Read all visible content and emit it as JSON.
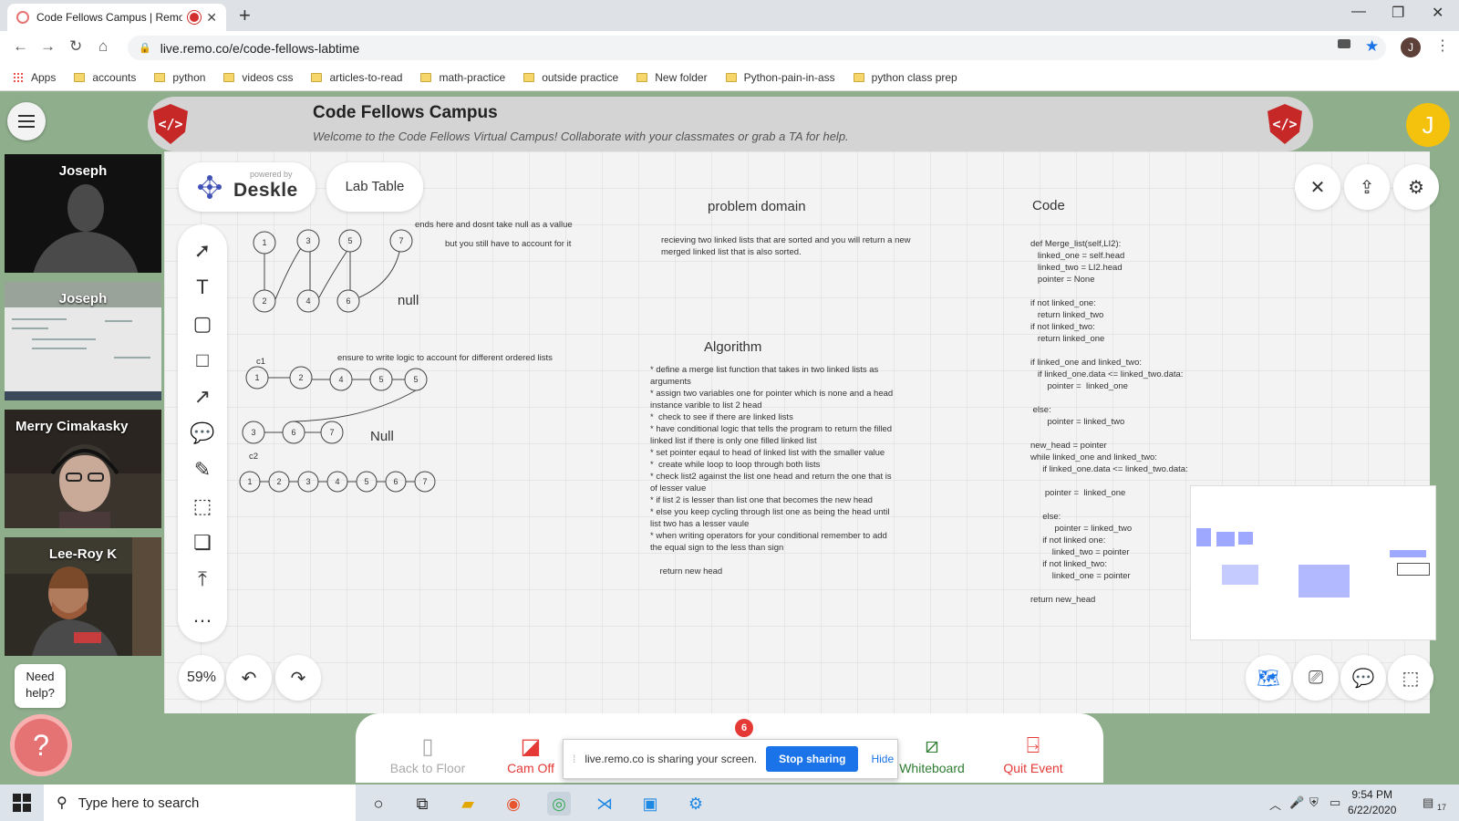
{
  "browser": {
    "tab_title": "Code Fellows Campus | Remo",
    "url": "live.remo.co/e/code-fellows-labtime",
    "profile_initial": "J",
    "bookmarks": [
      "accounts",
      "python",
      "videos css",
      "articles-to-read",
      "math-practice",
      "outside practice",
      "New folder",
      "Python-pain-in-ass",
      "python class prep"
    ],
    "apps_label": "Apps"
  },
  "header": {
    "title": "Code Fellows Campus",
    "subtitle": "Welcome to the Code Fellows Virtual Campus! Collaborate with your classmates or grab a TA for help.",
    "logo_text": "</>",
    "user_initial": "J"
  },
  "participants": [
    {
      "name": "Joseph"
    },
    {
      "name": "Joseph"
    },
    {
      "name": "Merry Cimakasky"
    },
    {
      "name": "Lee-Roy K"
    }
  ],
  "whiteboard": {
    "powered_by": "powered by",
    "brand": "Deskle",
    "table_name": "Lab Table",
    "zoom": "59%",
    "headings": {
      "problem_domain": "problem domain",
      "code": "Code",
      "algorithm": "Algorithm"
    },
    "notes": {
      "ends_here": "ends here and dosnt take null as a vallue",
      "account_for": "but you still have to account for it",
      "null_1": "null",
      "ensure": "ensure to write logic to account for different ordered lists",
      "null_2": "Null",
      "c1": "c1",
      "c2": "c2"
    },
    "diagram_nodes": {
      "row1_top": [
        "1",
        "3",
        "5",
        "7"
      ],
      "row1_bottom": [
        "2",
        "4",
        "6"
      ],
      "list_c1": [
        "1",
        "2",
        "4",
        "5",
        "5"
      ],
      "list_c2": [
        "3",
        "6",
        "7"
      ],
      "merged": [
        "1",
        "2",
        "3",
        "4",
        "5",
        "6",
        "7"
      ]
    },
    "problem_text": [
      "recieving two linked lists that are sorted and you will return a new",
      "merged linked list that is also sorted."
    ],
    "algorithm_text": [
      "* define a merge list function that takes in two linked lists as",
      "arguments",
      "* assign two variables one for pointer which is none and a head",
      "instance varible to list 2 head",
      "*  check to see if there are linked lists",
      "* have conditional logic that tells the program to return the filled",
      "linked list if there is only one filled linked list",
      "* set pointer eqaul to head of linked list with the smaller value",
      "*  create while loop to loop through both lists",
      "* check list2 against the list one head and return the one that is",
      "of lesser value",
      "* if list 2 is lesser than list one that becomes the new head",
      "* else you keep cycling through list one as being the head until",
      "list two has a lesser vaule",
      "* when writing operators for your conditional remember to add",
      "the equal sign to the less than sign",
      "",
      "    return new head"
    ],
    "code_lines": [
      "def Merge_list(self,LI2):",
      "   linked_one = self.head",
      "   linked_two = LI2.head",
      "   pointer = None",
      "",
      "if not linked_one:",
      "   return linked_two",
      "if not linked_two:",
      "   return linked_one",
      "",
      "if linked_one and linked_two:",
      "   if linked_one.data <= linked_two.data:",
      "       pointer =  linked_one",
      "",
      " else:",
      "       pointer = linked_two",
      "",
      "new_head = pointer",
      "while linked_one and linked_two:",
      "     if linked_one.data <= linked_two.data:",
      "",
      "      pointer =  linked_one",
      "",
      "     else:",
      "          pointer = linked_two",
      "     if not linked one:",
      "         linked_two = pointer",
      "     if not linked_two:",
      "         linked_one = pointer",
      "",
      "return new_head"
    ]
  },
  "controls": {
    "back_to_floor": "Back to Floor",
    "cam_off": "Cam Off",
    "whiteboard": "Whiteboard",
    "quit_event": "Quit Event",
    "chat_badge": "6",
    "sharing_text": "live.remo.co is sharing your screen.",
    "stop_sharing": "Stop sharing",
    "hide": "Hide",
    "need_help": "Need help?"
  },
  "taskbar": {
    "search_placeholder": "Type here to search",
    "time": "9:54 PM",
    "date": "6/22/2020",
    "notification_count": "17"
  },
  "colors": {
    "accent_red": "#e53935",
    "remo_blue": "#1a73e8",
    "help_pink": "#e57373",
    "whiteboard_green": "#2e7d32"
  }
}
